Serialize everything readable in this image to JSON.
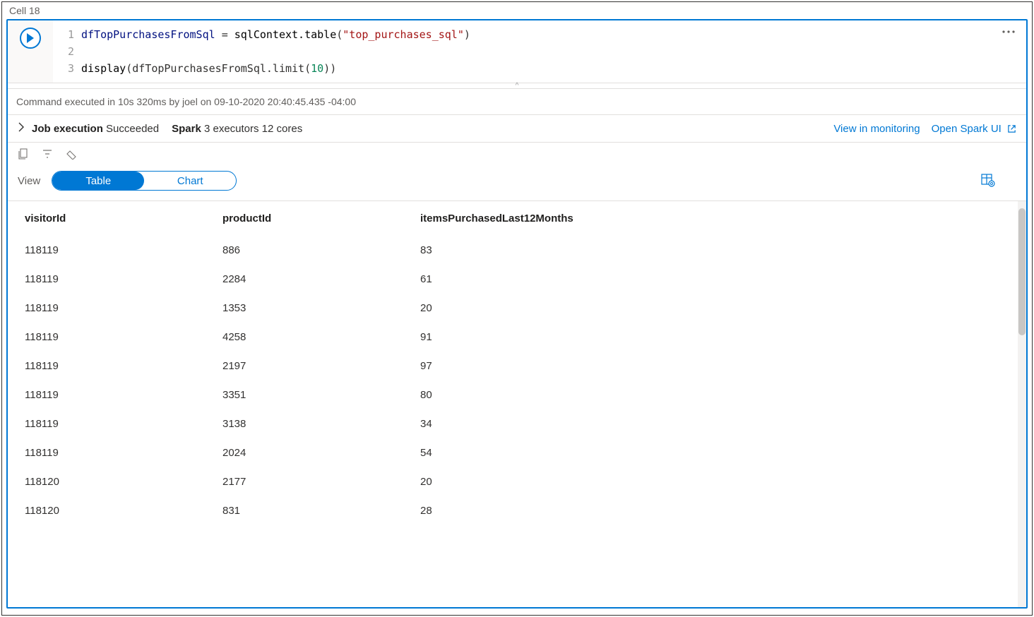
{
  "cell_label": "Cell 18",
  "code": {
    "lines": [
      "1",
      "2",
      "3"
    ],
    "l1_var": "dfTopPurchasesFromSql ",
    "l1_eq": "= ",
    "l1_fn": "sqlContext.table",
    "l1_p1": "(",
    "l1_str": "\"top_purchases_sql\"",
    "l1_p2": ")",
    "l3_fn": "display",
    "l3_p1": "(dfTopPurchasesFromSql.limit(",
    "l3_num": "10",
    "l3_p2": "))"
  },
  "status_text": "Command executed in 10s 320ms by joel on 09-10-2020 20:40:45.435 -04:00",
  "job": {
    "label": "Job execution",
    "status": "Succeeded",
    "spark_label": "Spark",
    "spark_detail": "3 executors 12 cores",
    "view_monitoring": "View in monitoring",
    "open_spark": "Open Spark UI"
  },
  "view": {
    "label": "View",
    "table": "Table",
    "chart": "Chart"
  },
  "table": {
    "columns": [
      "visitorId",
      "productId",
      "itemsPurchasedLast12Months"
    ],
    "rows": [
      [
        "118119",
        "886",
        "83"
      ],
      [
        "118119",
        "2284",
        "61"
      ],
      [
        "118119",
        "1353",
        "20"
      ],
      [
        "118119",
        "4258",
        "91"
      ],
      [
        "118119",
        "2197",
        "97"
      ],
      [
        "118119",
        "3351",
        "80"
      ],
      [
        "118119",
        "3138",
        "34"
      ],
      [
        "118119",
        "2024",
        "54"
      ],
      [
        "118120",
        "2177",
        "20"
      ],
      [
        "118120",
        "831",
        "28"
      ]
    ]
  }
}
